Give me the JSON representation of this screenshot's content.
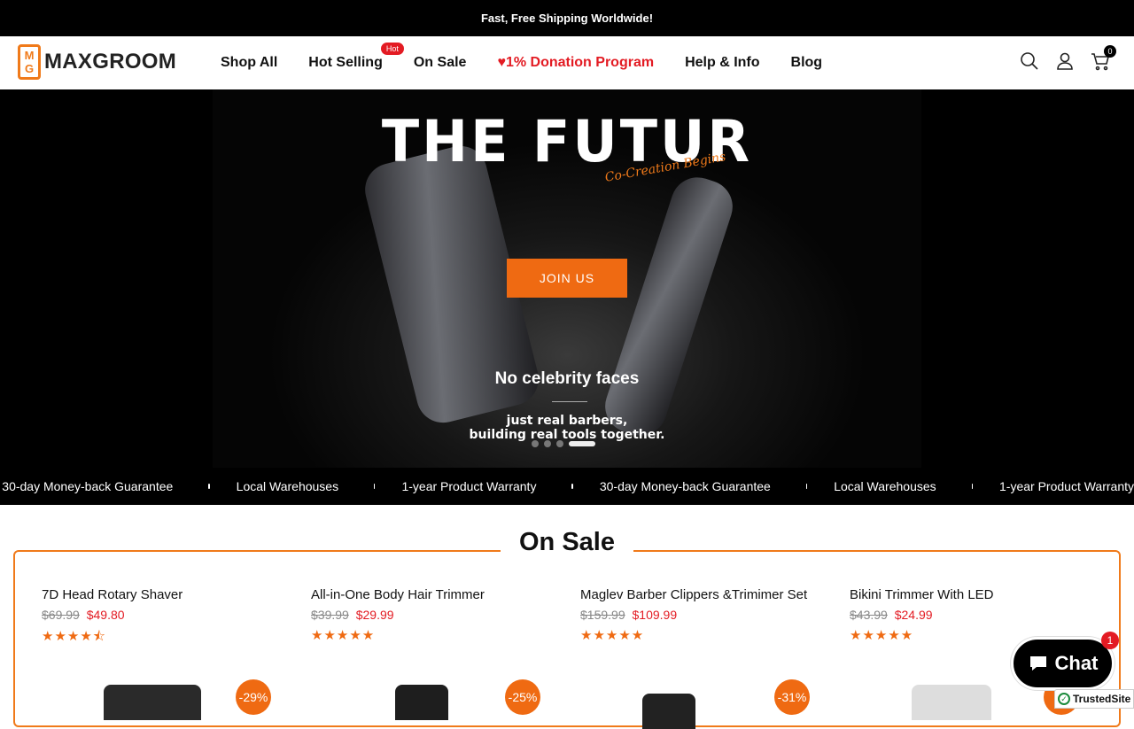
{
  "announcement": "Fast, Free Shipping Worldwide!",
  "brand": {
    "mark_top": "M",
    "mark_bottom": "G",
    "name": "MAXGROOM"
  },
  "nav": {
    "shop_all": "Shop All",
    "hot_selling": "Hot Selling",
    "hot_badge": "Hot",
    "on_sale": "On Sale",
    "donation_heart": "♥",
    "donation": "1% Donation Program",
    "help": "Help & Info",
    "blog": "Blog"
  },
  "header_icons": {
    "search": "search-icon",
    "account": "user-icon",
    "cart": "cart-icon",
    "cart_count": "0"
  },
  "hero": {
    "title": "THE FUTUR",
    "tagline": "Co-Creation Begins",
    "cta": "JOIN US",
    "subtitle": "No celebrity faces",
    "line1": "just real barbers,",
    "line2": "building real tools together.",
    "slide_count": 4,
    "active_slide": 4
  },
  "marquee": [
    "30-day Money-back Guarantee",
    "Local Warehouses",
    "1-year Product Warranty",
    "30-day Money-back Guarantee",
    "Local Warehouses",
    "1-year Product Warranty"
  ],
  "sale": {
    "title": "On Sale",
    "products": [
      {
        "name": "7D Head Rotary Shaver",
        "old_price": "$69.99",
        "price": "$49.80",
        "stars": "★★★★⯪",
        "rating": 4.5,
        "discount": "-29%"
      },
      {
        "name": "All-in-One Body Hair Trimmer",
        "old_price": "$39.99",
        "price": "$29.99",
        "stars": "★★★★★",
        "rating": 5,
        "discount": "-25%"
      },
      {
        "name": "Maglev Barber Clippers &Trimimer Set",
        "old_price": "$159.99",
        "price": "$109.99",
        "stars": "★★★★★",
        "rating": 5,
        "discount": "-31%"
      },
      {
        "name": "Bikini Trimmer With LED",
        "old_price": "$43.99",
        "price": "$24.99",
        "stars": "★★★★★",
        "rating": 5,
        "discount": "-"
      }
    ]
  },
  "chat": {
    "label": "Chat",
    "badge": "1"
  },
  "trusted": "TrustedSite",
  "colors": {
    "accent": "#ef6a12",
    "sale_red": "#e31b23",
    "dark": "#000000"
  }
}
